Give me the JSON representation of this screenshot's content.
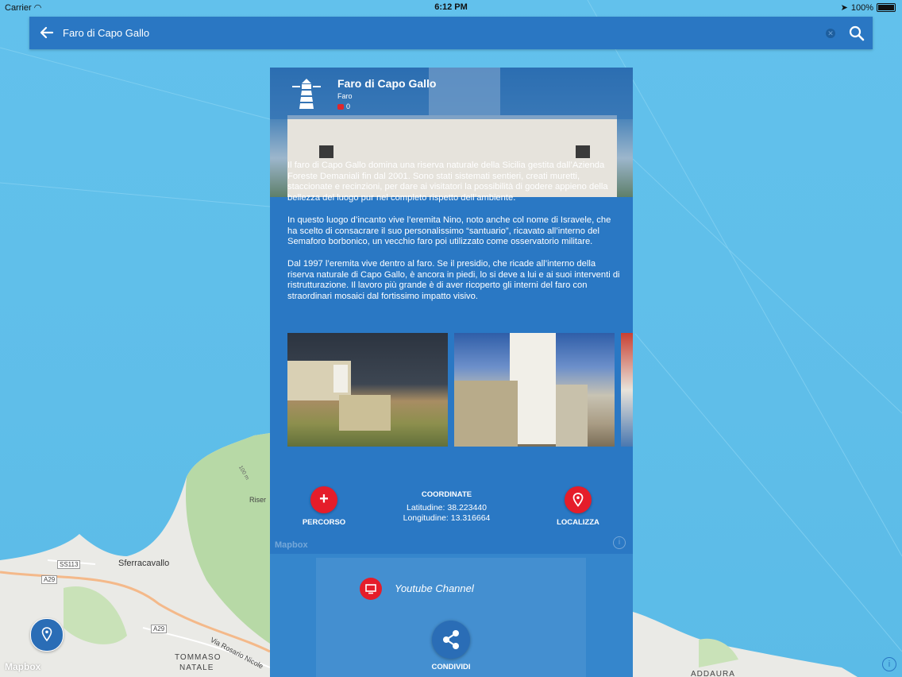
{
  "status_bar": {
    "carrier": "Carrier",
    "time": "6:12 PM",
    "battery": "100%"
  },
  "search": {
    "query": "Faro di Capo Gallo"
  },
  "poi": {
    "title": "Faro di Capo Gallo",
    "category": "Faro",
    "likes": "0",
    "paragraphs": [
      "Il faro di Capo Gallo domina una riserva naturale della Sicilia gestita dall’Azienda Foreste Demaniali fin dal 2001. Sono stati sistemati sentieri, creati muretti, staccionate e recinzioni, per dare ai visitatori la possibilità di godere appieno della bellezza del luogo pur nel completo rispetto dell’ambiente.",
      "In questo luogo d’incanto vive l’eremita Nino, noto anche col nome di Isravele, che ha scelto di consacrare il suo personalissimo “santuario”, ricavato all’interno del Semaforo borbonico, un vecchio faro poi utilizzato come osservatorio militare.",
      "Dal 1997 l’eremita vive dentro al faro. Se il presidio, che ricade all’interno della riserva naturale di Capo Gallo, è ancora in piedi, lo si deve a lui e ai suoi interventi di ristrutturazione. Il lavoro più grande è di aver ricoperto gli interni del faro con straordinari mosaici dal fortissimo impatto visivo."
    ]
  },
  "actions": {
    "route_label": "PERCORSO",
    "coords_title": "COORDINATE",
    "latitude": "Latitudine: 38.223440",
    "longitude": "Longitudine: 13.316664",
    "locate_label": "LOCALIZZA",
    "youtube_label": "Youtube Channel",
    "share_label": "CONDIVIDI"
  },
  "map": {
    "attribution": "Mapbox",
    "labels": {
      "sferracavallo": "Sferracavallo",
      "tommaso": "TOMMASO",
      "natale": "NATALE",
      "road_ss113": "SS113",
      "road_a29a": "A29",
      "road_a29b": "A29",
      "via_rosario": "Via Rosario Nicole",
      "riser": "Riser",
      "addaura": "ADDAURA",
      "contour_100": "100 m"
    }
  },
  "colors": {
    "accent": "#2a78c4",
    "button_red": "#e51d2a",
    "water": "#5fbee9"
  }
}
